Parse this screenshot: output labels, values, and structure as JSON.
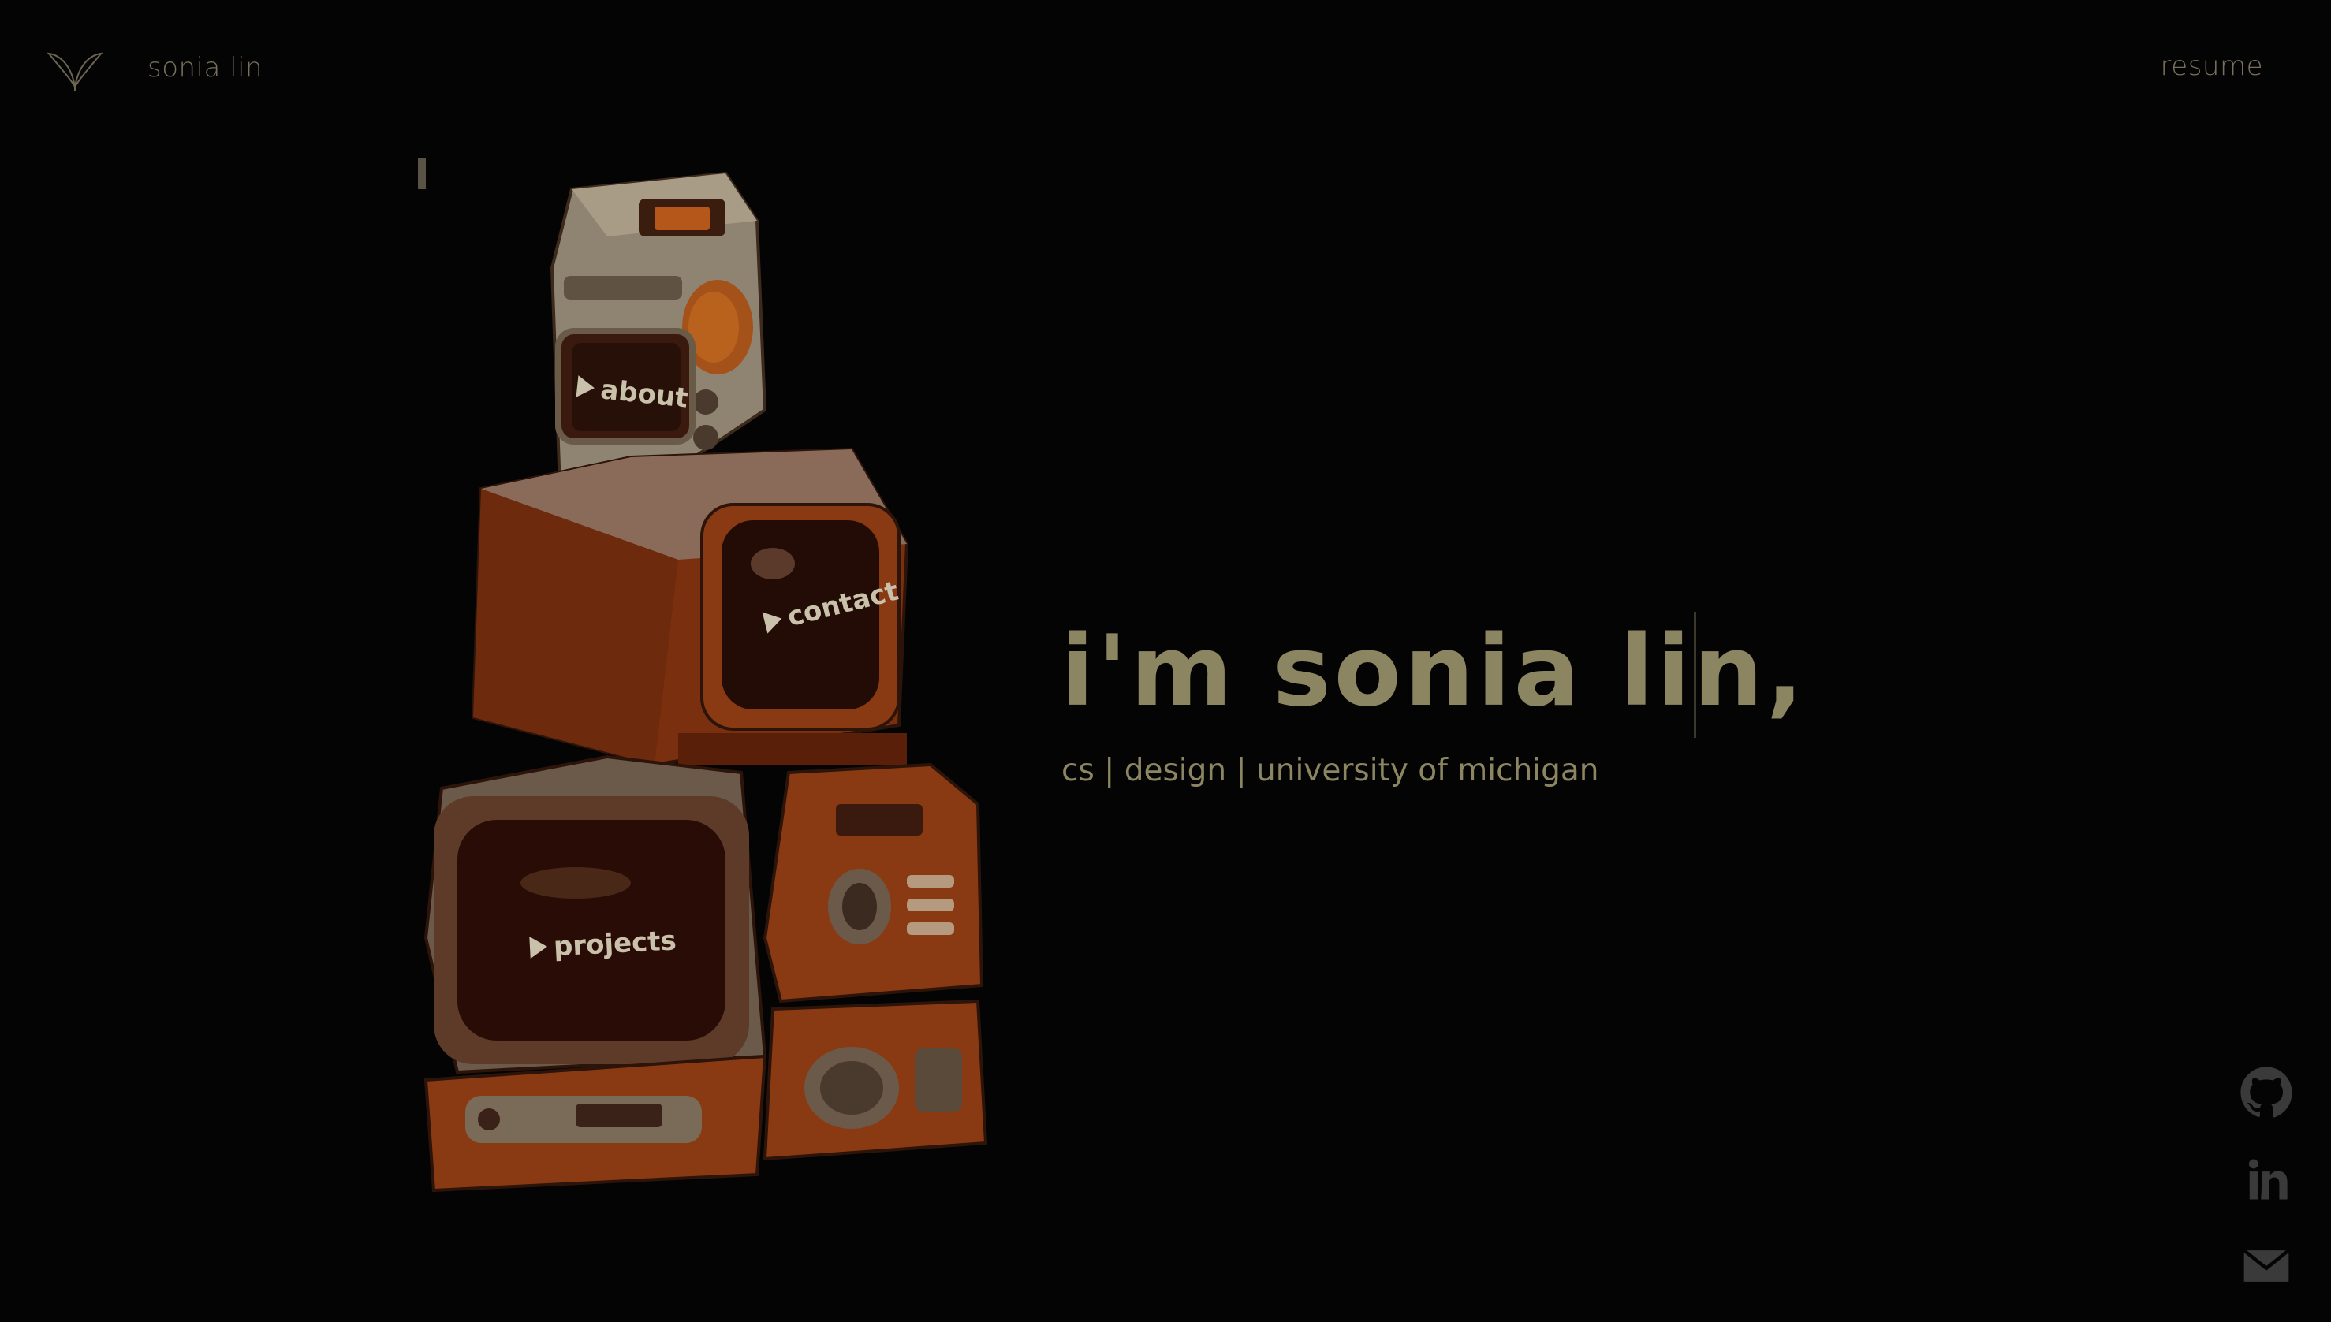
{
  "nav": {
    "logo_icon": "leaf-logo-icon",
    "name": "sonia lin",
    "resume_label": "resume"
  },
  "illustration": {
    "subject": "stacked retro tvs",
    "buttons": [
      {
        "label": "about",
        "icon": "play-icon"
      },
      {
        "label": "contact",
        "icon": "play-icon"
      },
      {
        "label": "projects",
        "icon": "play-icon"
      }
    ]
  },
  "hero": {
    "title": "i'm sonia lin,",
    "subtitle": "cs | design | university of michigan"
  },
  "social": [
    {
      "name": "github",
      "icon": "github-icon"
    },
    {
      "name": "linkedin",
      "icon": "linkedin-icon"
    },
    {
      "name": "email",
      "icon": "mail-icon"
    }
  ],
  "colors": {
    "background": "#050404",
    "text_muted": "#77705c",
    "hero_text": "#8b8562",
    "tv_orange": "#8a3a12",
    "tv_cream": "#8f8472"
  }
}
